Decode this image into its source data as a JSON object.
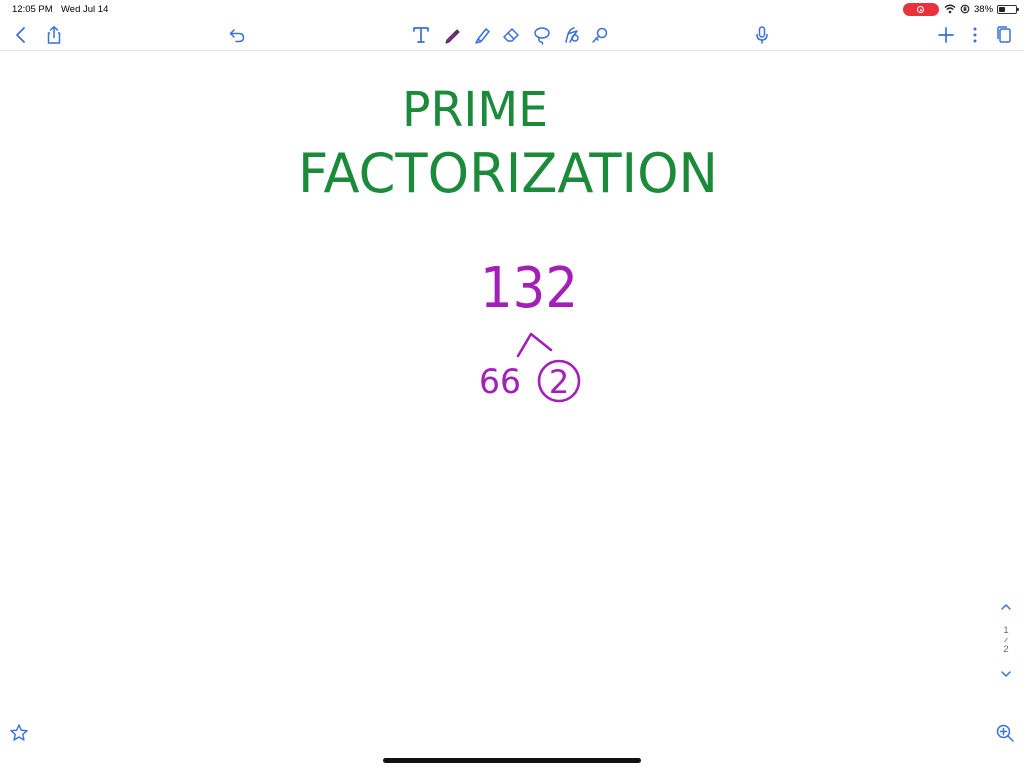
{
  "status_bar": {
    "time": "12:05 PM",
    "date": "Wed Jul 14",
    "battery": "38%",
    "battery_level": 0.38,
    "recording_color": "#e8333f"
  },
  "toolbar": {
    "icons": [
      "chevron-left",
      "share",
      "undo",
      "text-tool",
      "pen-tool",
      "highlighter",
      "eraser",
      "lasso",
      "shapes",
      "laser-pointer",
      "microphone",
      "add",
      "more",
      "pages"
    ],
    "accent_color": "#3b6fd9"
  },
  "canvas": {
    "title_line_1": "PRIME",
    "title_line_2": "FACTORIZATION",
    "number": "132",
    "factor_left": "66",
    "factor_right": "2",
    "title_color": "#1b8a3a",
    "math_color": "#a21fb8"
  },
  "page_nav": {
    "current": "1",
    "total": "2"
  }
}
